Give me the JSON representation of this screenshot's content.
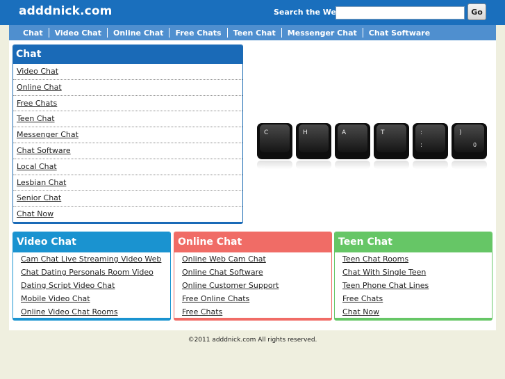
{
  "header": {
    "site_name": "adddnick.com",
    "search_label": "Search the Web:",
    "search_value": "",
    "go_label": "Go"
  },
  "nav": [
    "Chat",
    "Video Chat",
    "Online Chat",
    "Free Chats",
    "Teen Chat",
    "Messenger Chat",
    "Chat Software"
  ],
  "chat_box": {
    "title": "Chat",
    "links": [
      "Video Chat",
      "Online Chat",
      "Free Chats",
      "Teen Chat",
      "Messenger Chat",
      "Chat Software",
      "Local Chat",
      "Lesbian Chat",
      "Senior Chat",
      "Chat Now"
    ]
  },
  "keyboard_keys": [
    "C",
    "H",
    "A",
    "T",
    ":",
    ")"
  ],
  "panels": {
    "video": {
      "title": "Video Chat",
      "color": "#1a93d0",
      "links": [
        "Cam Chat Live Streaming Video Web",
        "Chat Dating Personals Room Video",
        "Dating Script Video Chat",
        "Mobile Video Chat",
        "Online Video Chat Rooms"
      ]
    },
    "online": {
      "title": "Online Chat",
      "color": "#f06c66",
      "links": [
        "Online Web Cam Chat",
        "Online Chat Software",
        "Online Customer Support",
        "Free Online Chats",
        "Free Chats"
      ]
    },
    "teen": {
      "title": "Teen Chat",
      "color": "#66c666",
      "links": [
        "Teen Chat Rooms",
        "Chat With Single Teen",
        "Teen Phone Chat Lines",
        "Free Chats",
        "Chat Now"
      ]
    }
  },
  "footer": {
    "text": "©2011 adddnick.com All rights reserved."
  },
  "colors": {
    "header_bg": "#1a6fbd",
    "nav_bg": "#4f8fcf",
    "page_bg": "#efefdf"
  }
}
